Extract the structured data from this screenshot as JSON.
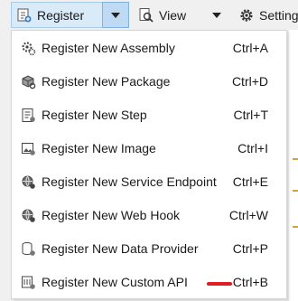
{
  "toolbar": {
    "register_label": "Register",
    "view_label": "View",
    "settings_label": "Settings"
  },
  "menu": {
    "items": [
      {
        "label": "Register New Assembly",
        "shortcut": "Ctrl+A",
        "icon": "assembly-gear-icon"
      },
      {
        "label": "Register New Package",
        "shortcut": "Ctrl+D",
        "icon": "package-icon"
      },
      {
        "label": "Register New Step",
        "shortcut": "Ctrl+T",
        "icon": "step-document-icon"
      },
      {
        "label": "Register New Image",
        "shortcut": "Ctrl+I",
        "icon": "image-icon"
      },
      {
        "label": "Register New Service Endpoint",
        "shortcut": "Ctrl+E",
        "icon": "service-endpoint-globe-icon"
      },
      {
        "label": "Register New Web Hook",
        "shortcut": "Ctrl+W",
        "icon": "web-hook-globe-icon"
      },
      {
        "label": "Register New Data Provider",
        "shortcut": "Ctrl+P",
        "icon": "data-provider-icon"
      },
      {
        "label": "Register New Custom API",
        "shortcut": "Ctrl+B",
        "icon": "custom-api-icon"
      }
    ]
  },
  "colors": {
    "register_button_bg": "#d9ebf9",
    "register_arrow_bg": "#bfdbf3",
    "annotation_mark": "#e31b23"
  }
}
